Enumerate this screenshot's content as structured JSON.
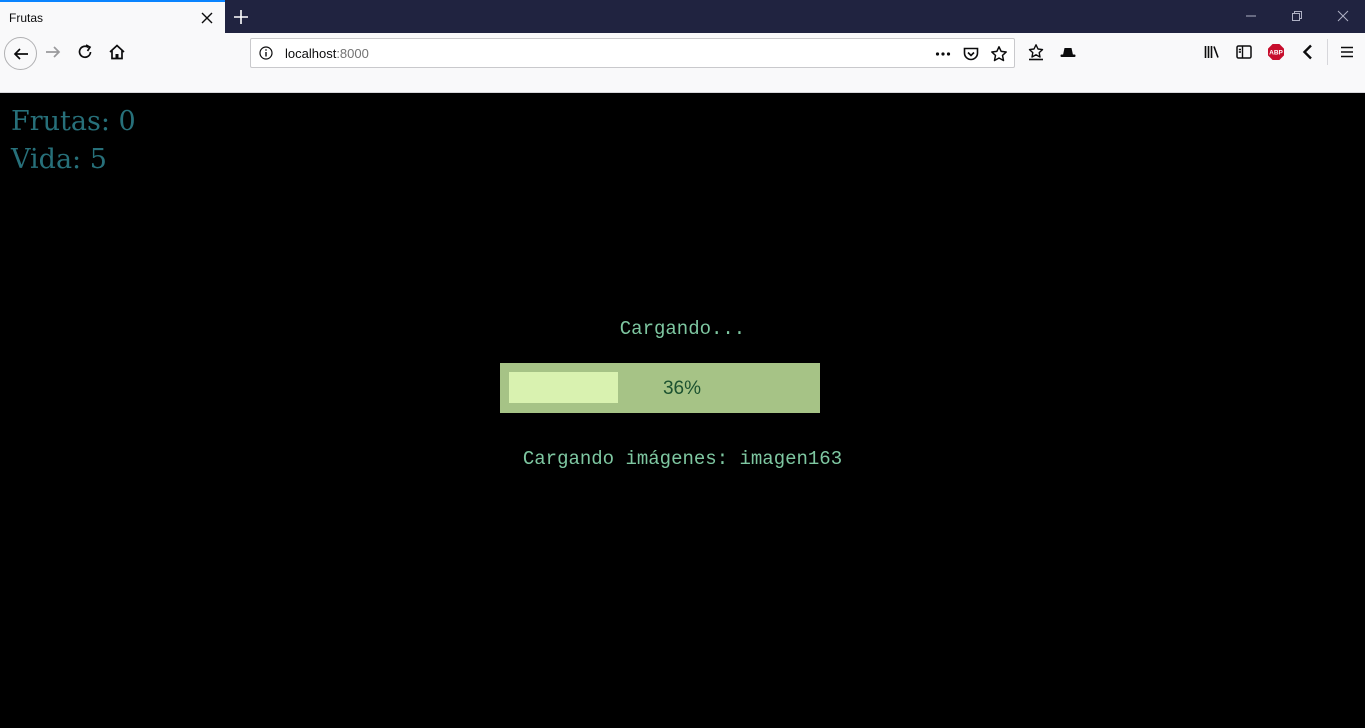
{
  "browser": {
    "tab": {
      "title": "Frutas"
    },
    "url": {
      "host": "localhost",
      "port": ":8000"
    }
  },
  "hud": {
    "frutas": "Frutas: 0",
    "vida": "Vida: 5"
  },
  "loader": {
    "title": "Cargando...",
    "progress_percent": 36,
    "progress_label": "36%",
    "status": "Cargando imágenes: imagen163"
  },
  "icons": {
    "tab_close": "close-icon",
    "new_tab": "plus-icon",
    "back": "arrow-left-icon",
    "forward": "arrow-right-icon",
    "reload": "reload-icon",
    "home": "home-icon",
    "site_info": "info-icon",
    "page_actions": "ellipsis-icon",
    "pocket": "pocket-icon",
    "bookmark": "star-icon",
    "bookmarks_menu": "star-list-icon",
    "hat": "hat-icon",
    "library": "library-icon",
    "sidebar": "sidebar-icon",
    "adblock": "abp-icon",
    "extension_arrow": "chevron-left-icon",
    "menu": "hamburger-icon"
  },
  "colors": {
    "hud_text": "#27707a",
    "loader_text": "#7ec7a1",
    "progress_box": "#a6c386",
    "progress_fill": "#d9f2b0",
    "progress_text": "#1c5230"
  }
}
